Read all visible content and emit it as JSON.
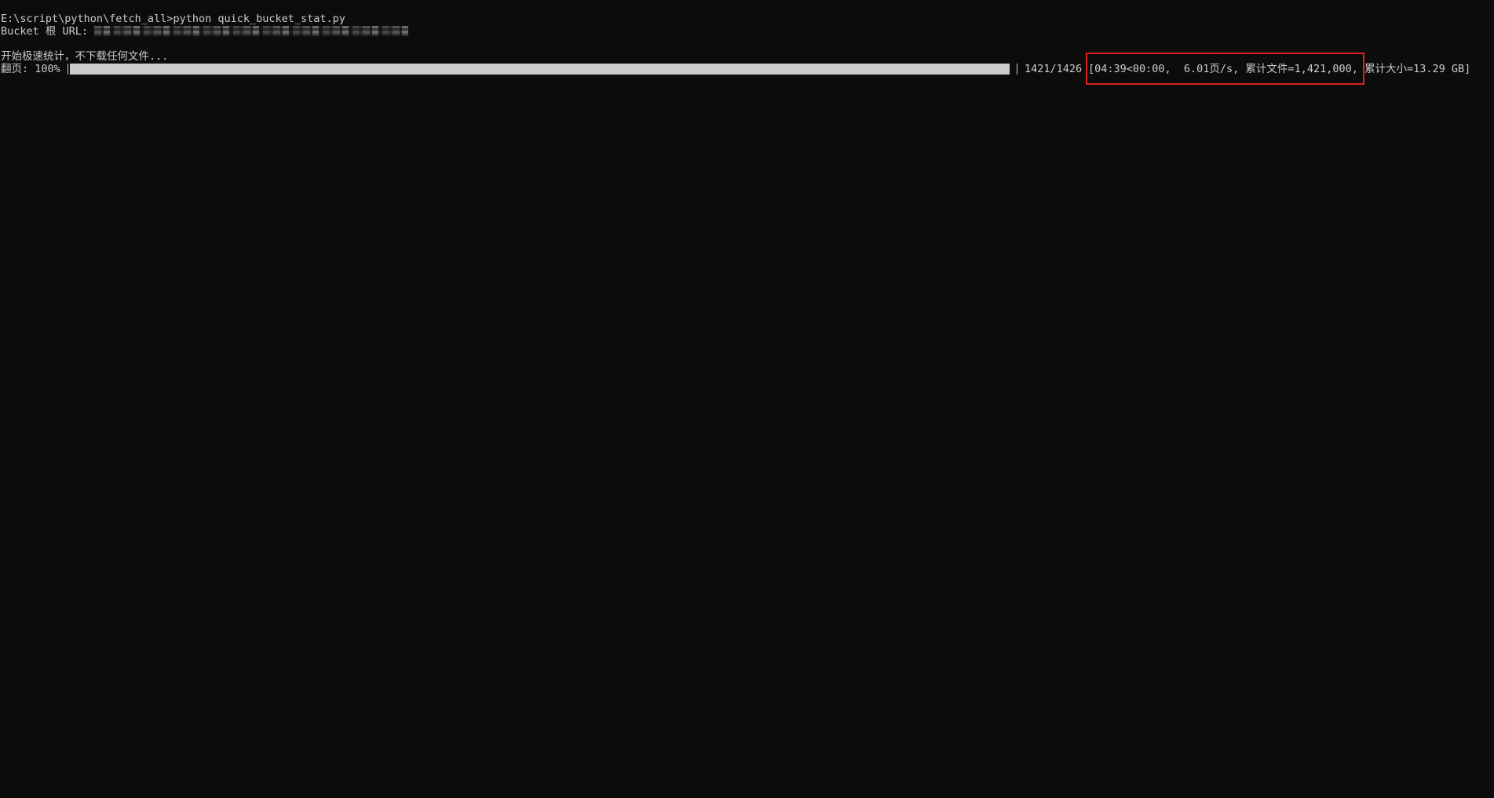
{
  "terminal": {
    "prompt": "E:\\script\\python\\fetch_all>",
    "command": "python quick_bucket_stat.py",
    "url_label": "Bucket 根 URL: ",
    "start_message": "开始极速统计，不下载任何文件...",
    "progress": {
      "label": "翻页: 100%",
      "fraction": 1.0,
      "count": "1421/1426",
      "stats": "[04:39<00:00,  6.01页/s, 累计文件=1,421,000, 累计大小=13.29 GB]"
    }
  },
  "colors": {
    "background": "#0c0c0c",
    "text": "#cccccc",
    "highlight": "#e02020"
  }
}
